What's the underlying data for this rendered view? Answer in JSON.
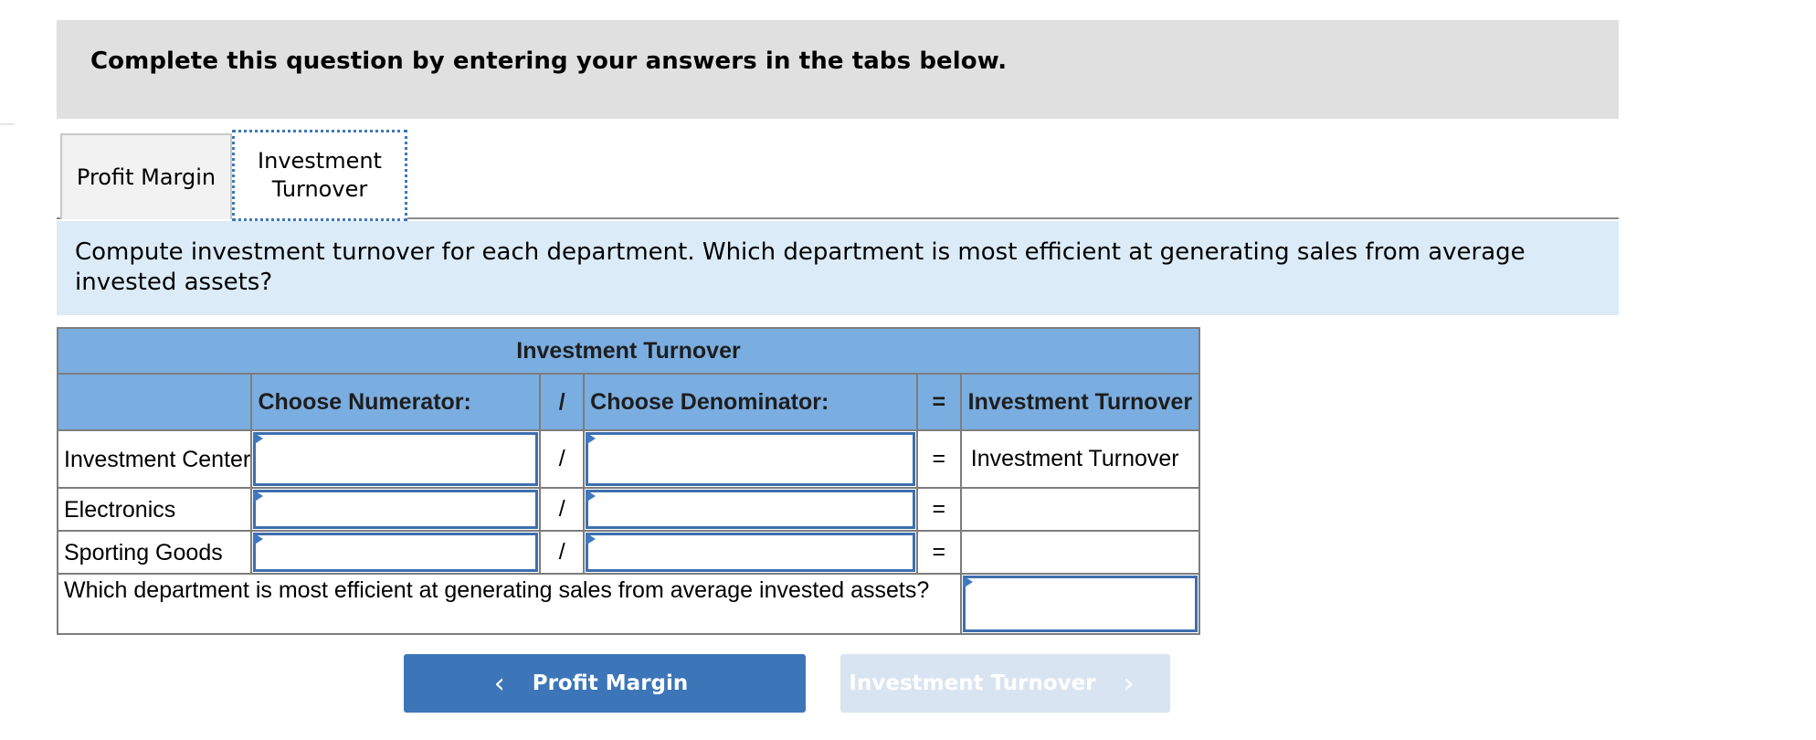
{
  "instruction": "Complete this question by entering your answers in the tabs below.",
  "tabs": [
    {
      "label": "Profit Margin",
      "active": false
    },
    {
      "label": "Investment\nTurnover",
      "label_line1": "Investment",
      "label_line2": "Turnover",
      "active": true
    }
  ],
  "prompt": "Compute investment turnover for each department. Which department is most efficient at generating sales from average invested assets?",
  "table": {
    "title": "Investment Turnover",
    "headers": {
      "numerator": "Choose Numerator:",
      "divide": "/",
      "denominator": "Choose Denominator:",
      "equals": "=",
      "result": "Investment Turnover"
    },
    "rows": [
      {
        "label": "Investment Center",
        "numerator": "",
        "divide": "/",
        "denominator": "",
        "equals": "=",
        "result": "Investment Turnover"
      },
      {
        "label": "Electronics",
        "numerator": "",
        "divide": "/",
        "denominator": "",
        "equals": "=",
        "result": ""
      },
      {
        "label": "Sporting Goods",
        "numerator": "",
        "divide": "/",
        "denominator": "",
        "equals": "=",
        "result": ""
      }
    ],
    "question": "Which department is most efficient at generating sales from average invested assets?",
    "answer": ""
  },
  "nav": {
    "prev_label": "Profit Margin",
    "next_label": "Investment Turnover",
    "prev_icon": "chevron-left-icon",
    "next_icon": "chevron-right-icon"
  },
  "colors": {
    "accent": "#3c76b8",
    "header_bg": "#7aade0",
    "prompt_bg": "#dbebf7",
    "instruction_bg": "#e0e0e0",
    "disabled_button": "#d8e4f1"
  }
}
